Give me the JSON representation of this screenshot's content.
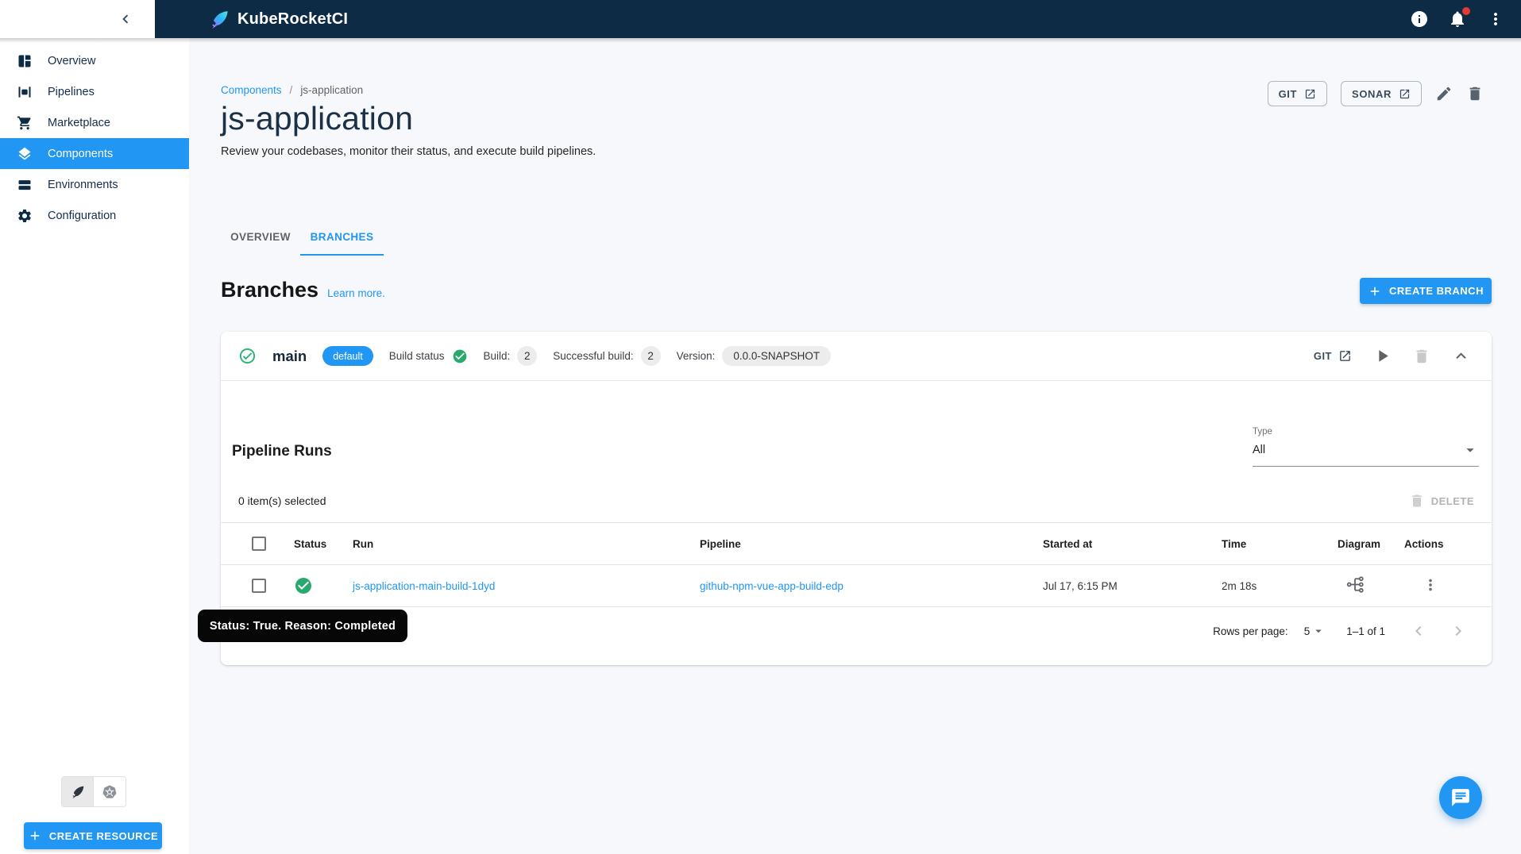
{
  "app_bar": {
    "title": "KubeRocketCI"
  },
  "sidebar": {
    "items": [
      {
        "label": "Overview"
      },
      {
        "label": "Pipelines"
      },
      {
        "label": "Marketplace"
      },
      {
        "label": "Components"
      },
      {
        "label": "Environments"
      },
      {
        "label": "Configuration"
      }
    ],
    "create_resource_label": "CREATE RESOURCE"
  },
  "breadcrumb": {
    "parent": "Components",
    "separator": "/",
    "current": "js-application"
  },
  "header": {
    "title": "js-application",
    "subtitle": "Review your codebases, monitor their status, and execute build pipelines.",
    "git_button": "GIT",
    "sonar_button": "SONAR"
  },
  "tabs": {
    "overview": "OVERVIEW",
    "branches": "BRANCHES"
  },
  "branches_section": {
    "heading": "Branches",
    "learn_more": "Learn more.",
    "create_branch": "CREATE BRANCH"
  },
  "branch": {
    "name": "main",
    "default_badge": "default",
    "build_status_label": "Build status",
    "build_label": "Build:",
    "build_count": "2",
    "successful_build_label": "Successful build:",
    "successful_build_count": "2",
    "version_label": "Version:",
    "version_value": "0.0.0-SNAPSHOT",
    "git_link": "GIT"
  },
  "pipeline_runs": {
    "heading": "Pipeline Runs",
    "type_label": "Type",
    "type_value": "All",
    "selected_text": "0 item(s) selected",
    "delete_label": "DELETE",
    "columns": [
      "Status",
      "Run",
      "Pipeline",
      "Started at",
      "Time",
      "Diagram",
      "Actions"
    ],
    "rows": [
      {
        "run": "js-application-main-build-1dyd",
        "pipeline": "github-npm-vue-app-build-edp",
        "started_at": "Jul 17, 6:15 PM",
        "time": "2m 18s"
      }
    ],
    "pagination": {
      "rows_per_page_label": "Rows per page:",
      "rows_per_page_value": "5",
      "range": "1–1 of 1"
    }
  },
  "tooltip": {
    "text": "Status: True. Reason: Completed"
  },
  "colors": {
    "accent": "#2196f3",
    "appbar": "#0d2b45",
    "success": "#2bae70",
    "notification": "#e53935"
  }
}
